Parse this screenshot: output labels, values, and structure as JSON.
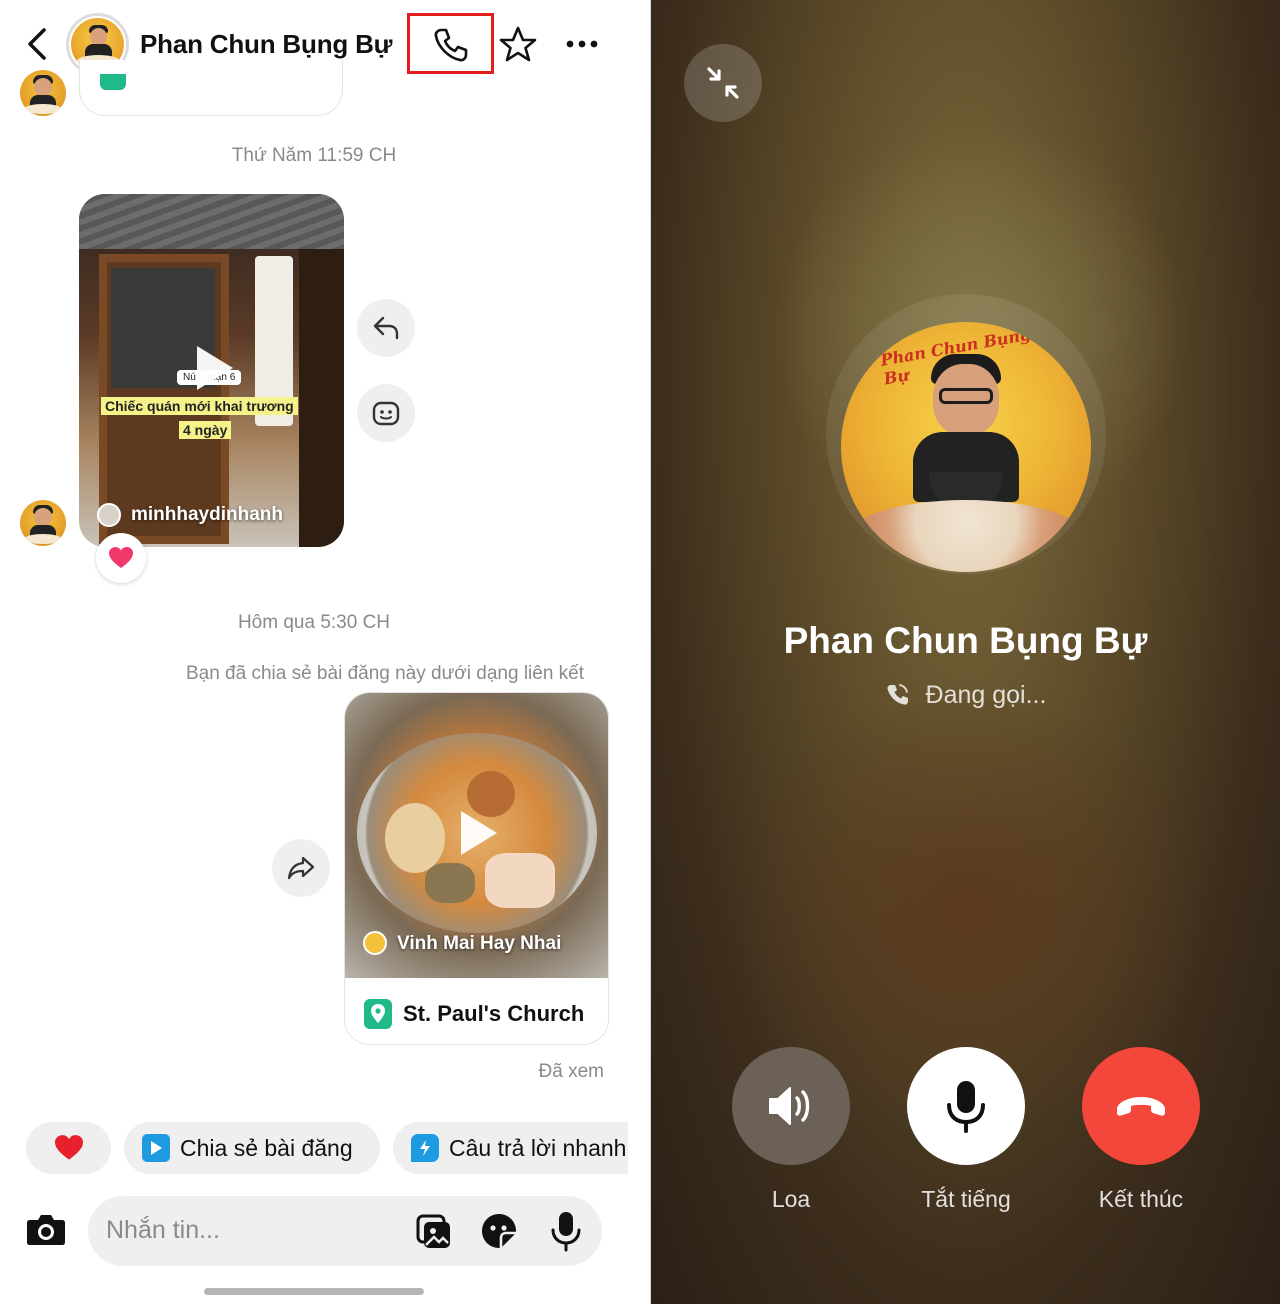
{
  "chat": {
    "header": {
      "title": "Phan Chun Bụng Bự",
      "back_icon": "chevron-left-icon",
      "call_icon": "phone-icon",
      "favorite_icon": "star-icon",
      "more_icon": "more-horizontal-icon",
      "highlight_color": "#e21d1d"
    },
    "messages": {
      "timestamp_1": "Thứ Năm 11:59 CH",
      "video_card": {
        "caption_tag": "Nú · quận 6",
        "caption_line1": "Chiếc quán mới khai trương",
        "caption_line2": "4 ngày",
        "username": "minhhaydinhanh"
      },
      "reaction": "heart",
      "timestamp_2": "Hôm qua 5:30 CH",
      "share_note": "Bạn đã chia sẻ bài đăng này dưới dạng liên kết",
      "food_card": {
        "username": "Vinh Mai Hay Nhai",
        "location": "St. Paul's Church"
      },
      "seen": "Đã xem"
    },
    "quick_replies": [
      {
        "label": ""
      },
      {
        "label": "Chia sẻ bài đăng"
      },
      {
        "label": "Câu trả lời nhanh"
      }
    ],
    "composer": {
      "placeholder": "Nhắn tin..."
    }
  },
  "call": {
    "name": "Phan Chun Bụng Bự",
    "status": "Đang gọi...",
    "avatar_text": "Phan Chun Bụng Bự",
    "buttons": [
      {
        "label": "Loa",
        "icon": "speaker-icon",
        "color": "#6b6157"
      },
      {
        "label": "Tắt tiếng",
        "icon": "microphone-icon",
        "color": "#ffffff"
      },
      {
        "label": "Kết thúc",
        "icon": "hang-up-icon",
        "color": "#f4473c"
      }
    ]
  }
}
